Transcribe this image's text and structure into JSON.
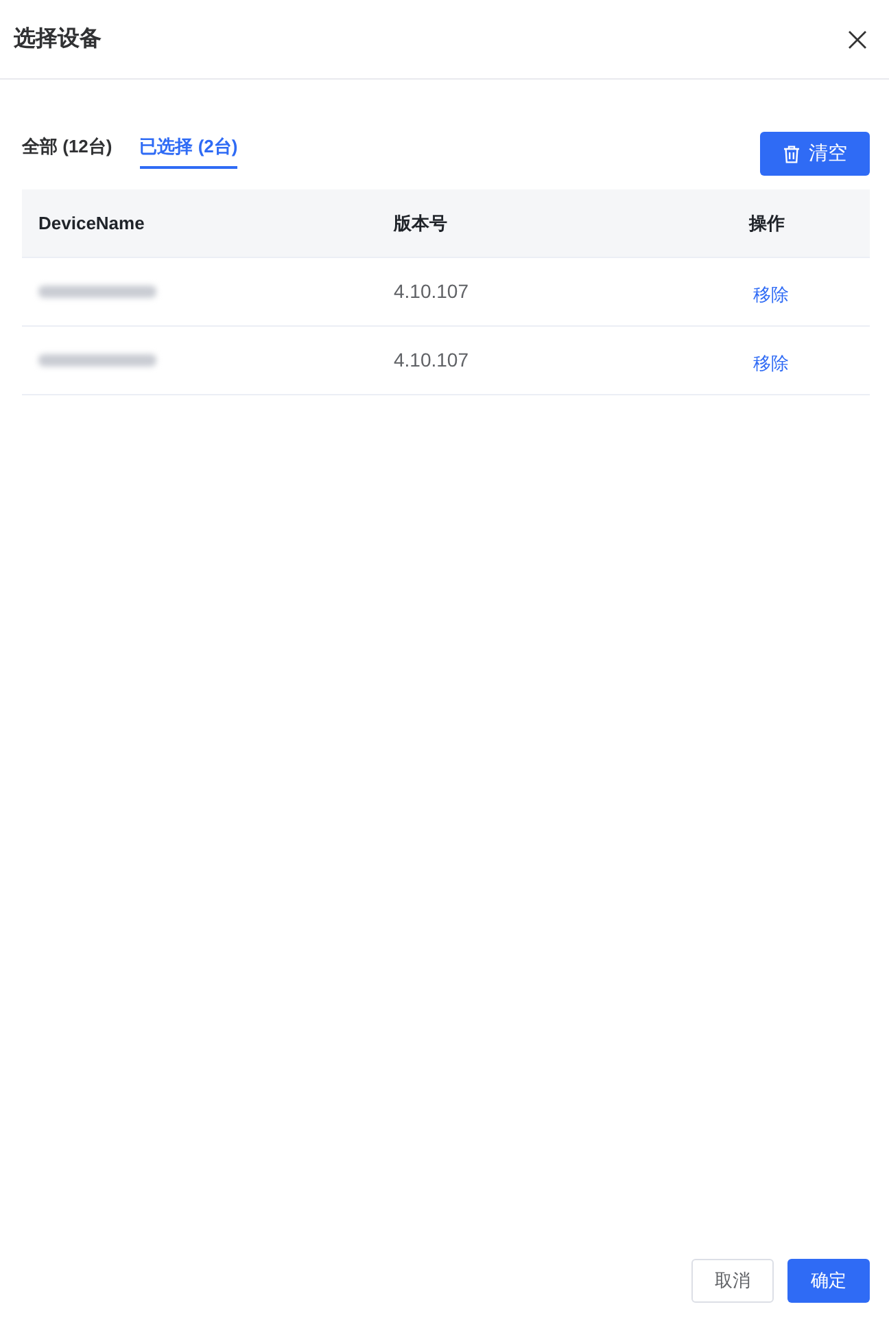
{
  "dialog": {
    "title": "选择设备"
  },
  "tabs": [
    {
      "label": "全部 (12台)",
      "selected": false
    },
    {
      "label": "已选择 (2台)",
      "selected": true
    }
  ],
  "clear_button": {
    "label": "清空"
  },
  "table": {
    "columns": [
      "DeviceName",
      "版本号",
      "操作"
    ],
    "rows": [
      {
        "name_redacted": true,
        "version": "4.10.107",
        "action": "移除"
      },
      {
        "name_redacted": true,
        "version": "4.10.107",
        "action": "移除"
      }
    ]
  },
  "footer": {
    "buttons": [
      {
        "label": "取消",
        "kind": "secondary"
      },
      {
        "label": "确定",
        "kind": "primary"
      }
    ]
  }
}
